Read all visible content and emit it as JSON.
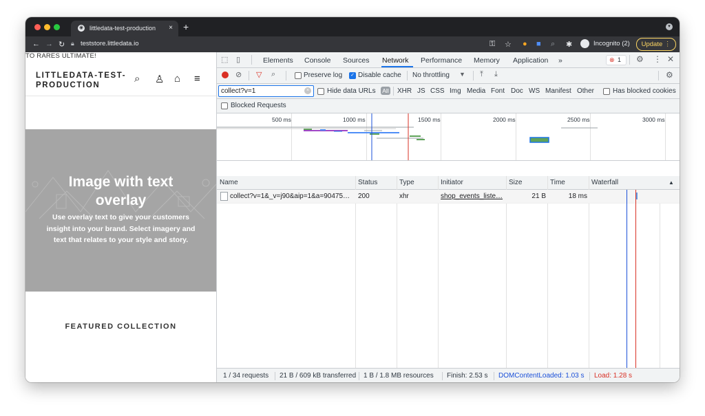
{
  "browser": {
    "tab_title": "littledata-test-production",
    "tab_close": "×",
    "new_tab": "+",
    "url": "teststore.littledata.io",
    "incognito_label": "Incognito (2)",
    "update_label": "Update"
  },
  "site": {
    "announcement": "TO RARES ULTIMATE!",
    "logo_line1": "LITTLEDATA-TEST-",
    "logo_line2": "PRODUCTION",
    "hero_title_line1": "Image with text",
    "hero_title_line2": "overlay",
    "hero_text_line1": "Use overlay text to give your customers",
    "hero_text_line2": "insight into your brand. Select imagery and",
    "hero_text_line3": "text that relates to your style and story.",
    "featured_heading": "FEATURED COLLECTION"
  },
  "devtools": {
    "tabs": [
      "Elements",
      "Console",
      "Sources",
      "Network",
      "Performance",
      "Memory",
      "Application"
    ],
    "more_tabs": "»",
    "error_count": "1",
    "preserve_log": "Preserve log",
    "disable_cache": "Disable cache",
    "throttling": "No throttling",
    "filter_value": "collect?v=1",
    "hide_data_urls": "Hide data URLs",
    "filter_types": [
      "All",
      "XHR",
      "JS",
      "CSS",
      "Img",
      "Media",
      "Font",
      "Doc",
      "WS",
      "Manifest",
      "Other"
    ],
    "has_blocked_cookies": "Has blocked cookies",
    "blocked_requests": "Blocked Requests",
    "timeline_ticks": [
      "500 ms",
      "1000 ms",
      "1500 ms",
      "2000 ms",
      "2500 ms",
      "3000 ms"
    ],
    "columns": [
      "Name",
      "Status",
      "Type",
      "Initiator",
      "Size",
      "Time",
      "Waterfall"
    ],
    "sort_indicator": "▲",
    "rows": [
      {
        "name": "collect?v=1&_v=j90&aip=1&a=90475…",
        "status": "200",
        "type": "xhr",
        "initiator": "shop_events_liste…",
        "size": "21 B",
        "time": "18 ms"
      }
    ],
    "status_bar": {
      "requests": "1 / 34 requests",
      "transferred": "21 B / 609 kB transferred",
      "resources": "1 B / 1.8 MB resources",
      "finish": "Finish: 2.53 s",
      "dom_content_loaded": "DOMContentLoaded: 1.03 s",
      "load": "Load: 1.28 s"
    }
  }
}
